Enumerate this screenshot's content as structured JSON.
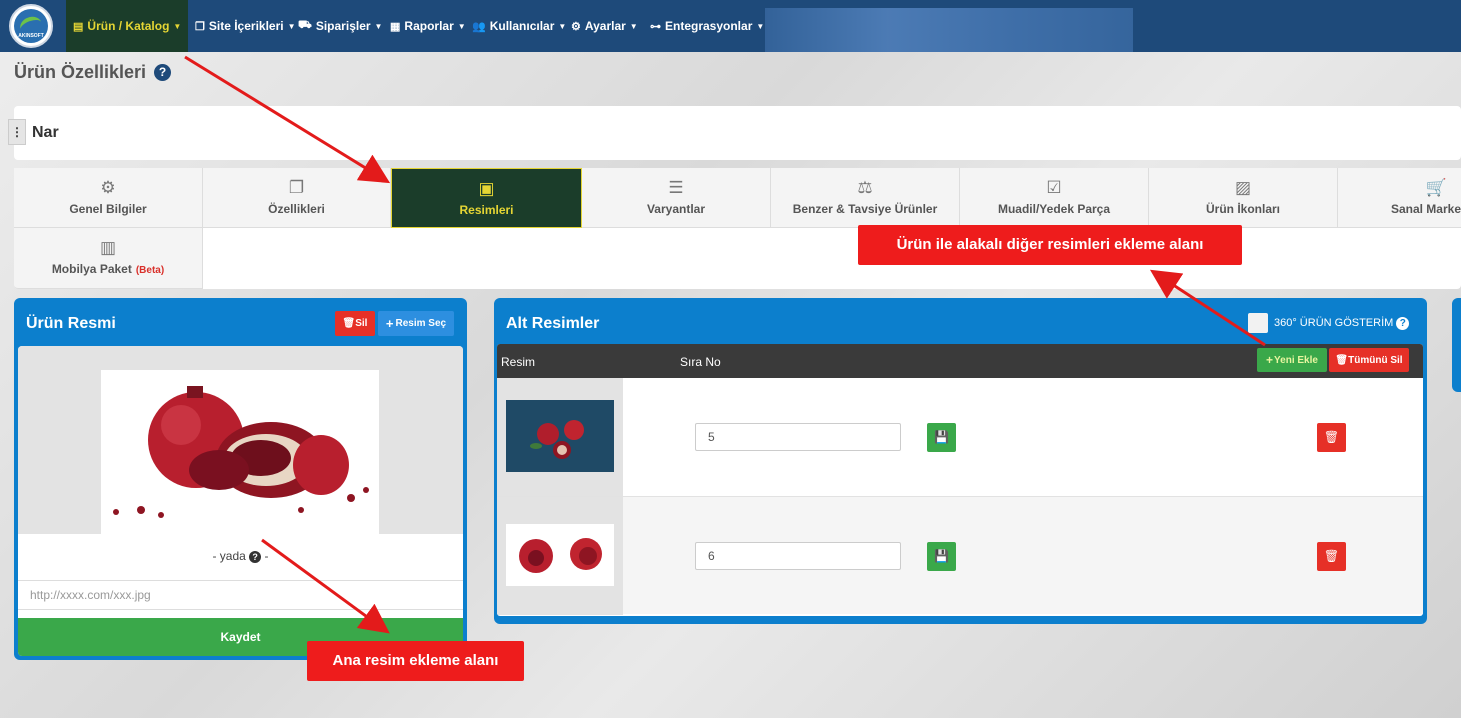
{
  "nav": {
    "logo_text": "AKINSOFT",
    "items": [
      {
        "label": "Ürün / Katalog",
        "icon": "cubes-icon"
      },
      {
        "label": "Site İçerikleri",
        "icon": "copy-icon"
      },
      {
        "label": "Siparişler",
        "icon": "truck-icon"
      },
      {
        "label": "Raporlar",
        "icon": "report-icon"
      },
      {
        "label": "Kullanıcılar",
        "icon": "users-icon"
      },
      {
        "label": "Ayarlar",
        "icon": "gears-icon"
      },
      {
        "label": "Entegrasyonlar",
        "icon": "sitemap-icon"
      }
    ]
  },
  "page": {
    "title": "Ürün Özellikleri",
    "help": "?"
  },
  "product": {
    "name": "Nar",
    "menu_glyph": "⋮"
  },
  "tabs": [
    {
      "label": "Genel Bilgiler",
      "icon": "gears-icon"
    },
    {
      "label": "Özellikleri",
      "icon": "copy-icon"
    },
    {
      "label": "Resimleri",
      "icon": "images-icon"
    },
    {
      "label": "Varyantlar",
      "icon": "bars-icon"
    },
    {
      "label": "Benzer & Tavsiye Ürünler",
      "icon": "balance-icon"
    },
    {
      "label": "Muadil/Yedek Parça",
      "icon": "checkbox-icon"
    },
    {
      "label": "Ürün İkonları",
      "icon": "file-image-icon"
    },
    {
      "label": "Sanal Marke",
      "icon": "cart-icon"
    },
    {
      "label": "Mobilya Paket",
      "beta": "(Beta)",
      "icon": "boxes-icon"
    }
  ],
  "main_image": {
    "title": "Ürün Resmi",
    "delete_label": "Sil",
    "select_label": "Resim Seç",
    "yada": "-  yada",
    "yada_end": "-",
    "url_placeholder": "http://xxxx.com/xxx.jpg",
    "save_label": "Kaydet"
  },
  "alt_images": {
    "title": "Alt Resimler",
    "show360_label": "360° ÜRÜN GÖSTERİM",
    "col_image": "Resim",
    "col_order": "Sıra No",
    "add_label": "Yeni Ekle",
    "delete_all_label": "Tümünü Sil",
    "rows": [
      {
        "order": "5"
      },
      {
        "order": "6"
      }
    ]
  },
  "annotations": {
    "alt_callout": "Ürün  ile  alakalı  diğer  resimleri  ekleme  alanı",
    "main_callout": "Ana  resim  ekleme  alanı"
  },
  "colors": {
    "nav_bg": "#1e4a7a",
    "active_tab_bg": "#1b3d2a",
    "active_text": "#e5d534",
    "panel_blue": "#0c7fcd",
    "danger": "#e63027",
    "success": "#3aa84a",
    "callout": "#ee1c1c"
  }
}
